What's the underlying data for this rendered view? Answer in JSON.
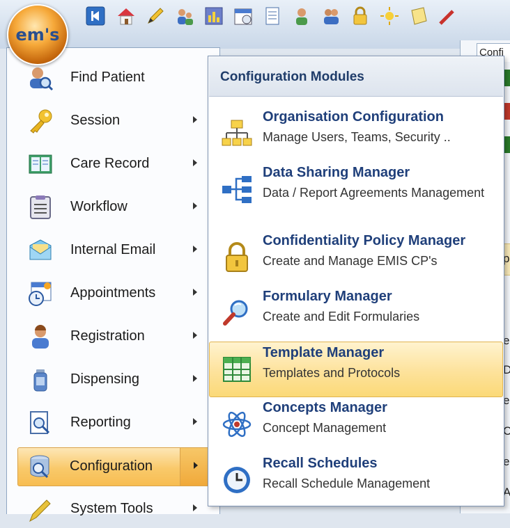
{
  "app": {
    "orb_label": "em's"
  },
  "toolbar": {
    "icons": [
      "back-icon",
      "home-icon",
      "pencil-icon",
      "users-icon",
      "chart-icon",
      "calendar-icon",
      "document-icon",
      "person-icon",
      "people-icon",
      "lock-icon",
      "sun-icon",
      "note-icon",
      "tool-icon"
    ]
  },
  "background": {
    "tab_label": "Confi",
    "right_letters": [
      "p",
      "e",
      "D",
      "e",
      "C",
      "e",
      "A"
    ]
  },
  "left_menu": {
    "items": [
      {
        "label": "Find Patient",
        "icon": "find-patient-icon",
        "has_arrow": false
      },
      {
        "label": "Session",
        "icon": "key-icon",
        "has_arrow": true
      },
      {
        "label": "Care Record",
        "icon": "care-record-icon",
        "has_arrow": true
      },
      {
        "label": "Workflow",
        "icon": "clipboard-icon",
        "has_arrow": true
      },
      {
        "label": "Internal Email",
        "icon": "envelope-icon",
        "has_arrow": true
      },
      {
        "label": "Appointments",
        "icon": "calendar-clock-icon",
        "has_arrow": true
      },
      {
        "label": "Registration",
        "icon": "person-icon",
        "has_arrow": true
      },
      {
        "label": "Dispensing",
        "icon": "bottle-icon",
        "has_arrow": true
      },
      {
        "label": "Reporting",
        "icon": "report-icon",
        "has_arrow": true
      },
      {
        "label": "Configuration",
        "icon": "database-icon",
        "has_arrow": true,
        "selected": true
      },
      {
        "label": "System Tools",
        "icon": "pencil-icon",
        "has_arrow": true
      }
    ]
  },
  "submenu": {
    "header": "Configuration Modules",
    "items": [
      {
        "title": "Organisation Configuration",
        "desc": "Manage Users, Teams, Security ..",
        "icon": "org-chart-icon"
      },
      {
        "title": "Data Sharing Manager",
        "desc": "Data / Report Agreements Management",
        "icon": "data-sharing-icon"
      },
      {
        "title": "Confidentiality Policy Manager",
        "desc": "Create and Manage EMIS CP's",
        "icon": "padlock-icon"
      },
      {
        "title": "Formulary Manager",
        "desc": "Create and Edit Formularies",
        "icon": "magnifier-icon"
      },
      {
        "title": "Template Manager",
        "desc": "Templates and Protocols",
        "icon": "grid-icon",
        "highlight": true
      },
      {
        "title": "Concepts Manager",
        "desc": "Concept Management",
        "icon": "atom-icon"
      },
      {
        "title": "Recall Schedules",
        "desc": "Recall Schedule Management",
        "icon": "clock-icon"
      }
    ]
  },
  "colors": {
    "accent": "#1f3f7a",
    "highlight": "#fde29b",
    "selected": "#f7bd52"
  }
}
